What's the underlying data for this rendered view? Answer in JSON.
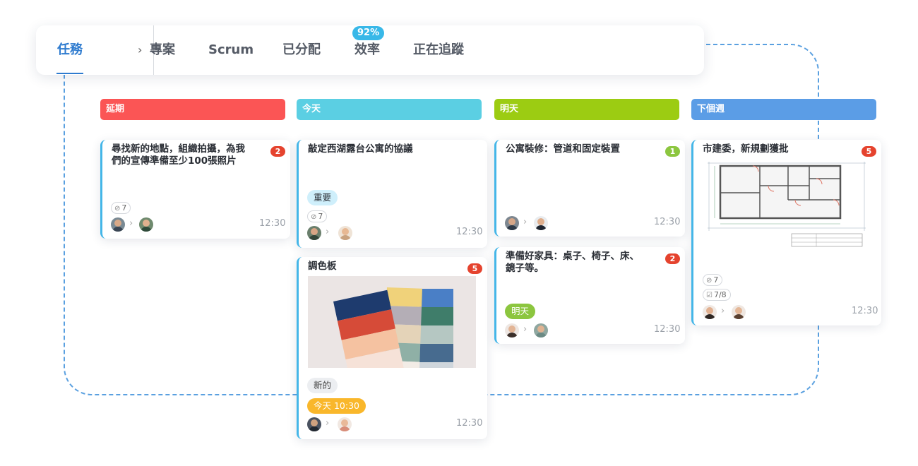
{
  "nav": {
    "items": [
      {
        "label": "任務",
        "active": true
      },
      {
        "label": "專案"
      },
      {
        "label": "Scrum"
      },
      {
        "label": "已分配"
      },
      {
        "label": "效率",
        "badge": "92%"
      },
      {
        "label": "正在追蹤"
      }
    ],
    "chevron": "›"
  },
  "columns": [
    {
      "title": "延期",
      "color": "#fb5555"
    },
    {
      "title": "今天",
      "color": "#5bcfe3"
    },
    {
      "title": "明天",
      "color": "#9ccc12"
    },
    {
      "title": "下個週",
      "color": "#5b9de6"
    }
  ],
  "cards": {
    "c1": {
      "title_lines": [
        "尋找新的地點，組織拍攝，為我",
        "們的宣傳準備至少100張照片"
      ],
      "count": "2",
      "attachments": "7",
      "time": "12:30"
    },
    "c2": {
      "title": "敲定西湖露台公寓的協議",
      "tag": "重要",
      "attachments": "7",
      "time": "12:30"
    },
    "c3": {
      "title": "調色板",
      "count": "5",
      "tag1": "新的",
      "tag2": "今天 10:30",
      "time": "12:30"
    },
    "c4": {
      "title": "公寓裝修：管道和固定裝置",
      "count": "1",
      "time": "12:30"
    },
    "c5": {
      "title_lines": [
        "準備好家具：桌子、椅子、床、",
        "鏡子等。"
      ],
      "count": "2",
      "tag": "明天",
      "time": "12:30"
    },
    "c6": {
      "title": "市建委，新規劃獲批",
      "count": "5",
      "attachments": "7",
      "checklist": "7/8",
      "time": "12:30"
    }
  },
  "icons": {
    "attachment": "paperclip-icon",
    "checklist": "checkbox-icon",
    "arrow": "chevron-right-icon"
  },
  "palette_colors": [
    "#1e3b6e",
    "#d64b38",
    "#f5c2a1",
    "#f0d27a",
    "#b4aeb6",
    "#e4d3b8",
    "#4a7fc6",
    "#3f7d6a",
    "#b5c7c2",
    "#476b8f"
  ]
}
